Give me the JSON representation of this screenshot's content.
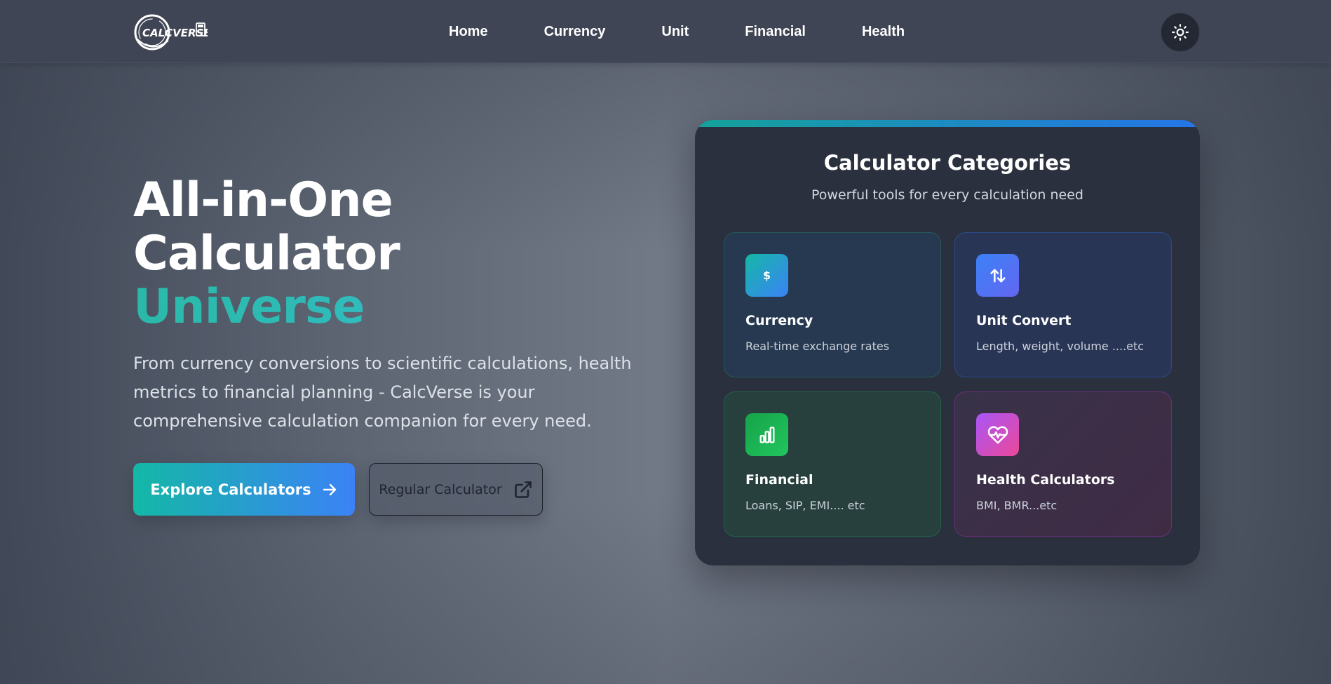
{
  "nav": {
    "logo_text": "CALCVERSE",
    "links": [
      "Home",
      "Currency",
      "Unit",
      "Financial",
      "Health"
    ],
    "theme_toggle_icon": "sun-icon"
  },
  "hero": {
    "title_line1": "All-in-One",
    "title_line2": "Calculator",
    "title_accent": "Universe",
    "description": "From currency conversions to scientific calculations, health metrics to financial planning - CalcVerse is your comprehensive calculation companion for every need.",
    "primary_button": "Explore Calculators",
    "primary_button_icon": "arrow-right-icon",
    "secondary_button": "Regular Calculator",
    "secondary_button_icon": "external-link-icon"
  },
  "categories": {
    "title": "Calculator Categories",
    "subtitle": "Powerful tools for every calculation need",
    "items": [
      {
        "name": "Currency",
        "desc": "Real-time exchange rates",
        "icon": "dollar-icon",
        "icon_glyph": "$"
      },
      {
        "name": "Unit Convert",
        "desc": "Length, weight, volume ....etc",
        "icon": "arrows-up-down-icon"
      },
      {
        "name": "Financial",
        "desc": "Loans, SIP, EMI.... etc",
        "icon": "bar-chart-icon"
      },
      {
        "name": "Health Calculators",
        "desc": "BMI, BMR...etc",
        "icon": "heart-pulse-icon"
      }
    ]
  },
  "colors": {
    "accent_teal": "#14b8a6",
    "accent_blue": "#3b82f6",
    "card_bg": "#2a303d",
    "nav_bg": "#3f4554"
  }
}
